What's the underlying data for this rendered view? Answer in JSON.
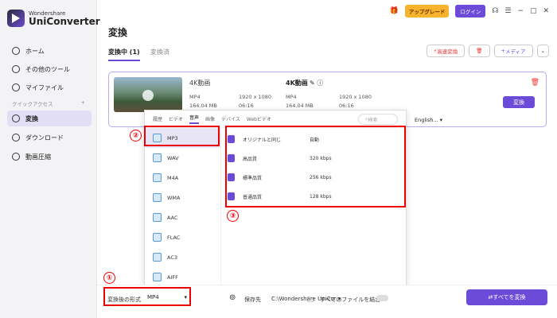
{
  "app": {
    "brand": "Wondershare",
    "product": "UniConverter"
  },
  "titlebar": {
    "upgrade": "アップグレード",
    "login": "ログイン"
  },
  "sidebar": {
    "items": [
      {
        "label": "ホーム",
        "icon": "home-icon"
      },
      {
        "label": "その他のツール",
        "icon": "tools-icon"
      },
      {
        "label": "マイファイル",
        "icon": "files-icon"
      },
      {
        "label": "変換",
        "icon": "convert-icon",
        "active": true
      },
      {
        "label": "ダウンロード",
        "icon": "download-icon"
      },
      {
        "label": "動画圧縮",
        "icon": "compress-icon"
      }
    ],
    "quick_access": "クイックアクセス",
    "quick_add": "+"
  },
  "main": {
    "title": "変換",
    "tabs": [
      {
        "label": "変換中 (1)",
        "active": true
      },
      {
        "label": "変換済"
      }
    ],
    "fast_convert": "高速変換",
    "media": "メディア"
  },
  "card": {
    "source": {
      "name": "4K動画",
      "format": "MP4",
      "resolution": "1920 x 1080",
      "size": "164.04 MB",
      "duration": "06:16"
    },
    "target": {
      "name": "4K動画",
      "format": "MP4",
      "resolution": "1920 x 1080",
      "size": "164.04 MB",
      "duration": "06:16"
    },
    "convert_button": "変換",
    "language": "English..."
  },
  "popup": {
    "tabs": [
      "履歴",
      "ビデオ",
      "音声",
      "画像",
      "デバイス",
      "Webビデオ"
    ],
    "active_tab": "音声",
    "search_placeholder": "検索",
    "formats": [
      "MP3",
      "WAV",
      "M4A",
      "WMA",
      "AAC",
      "FLAC",
      "AC3",
      "AIFF"
    ],
    "selected_format": "MP3",
    "qualities": [
      {
        "name": "オリジナルと同じ",
        "value": "自動"
      },
      {
        "name": "高品質",
        "value": "320 kbps"
      },
      {
        "name": "標準品質",
        "value": "256 kbps"
      },
      {
        "name": "普通品質",
        "value": "128 kbps"
      }
    ]
  },
  "bottom": {
    "output_format_label": "変換後の形式",
    "output_format_value": "MP4",
    "save_label": "保存先",
    "save_path": "C:\\Wondershare UniCor",
    "merge_label": "すべてのファイルを結合",
    "convert_all": "すべてを変換"
  },
  "annotations": [
    "①",
    "②",
    "③"
  ],
  "colors": {
    "accent": "#6b4bd8",
    "annotation": "#e00000",
    "upgrade": "#f7b32b"
  }
}
